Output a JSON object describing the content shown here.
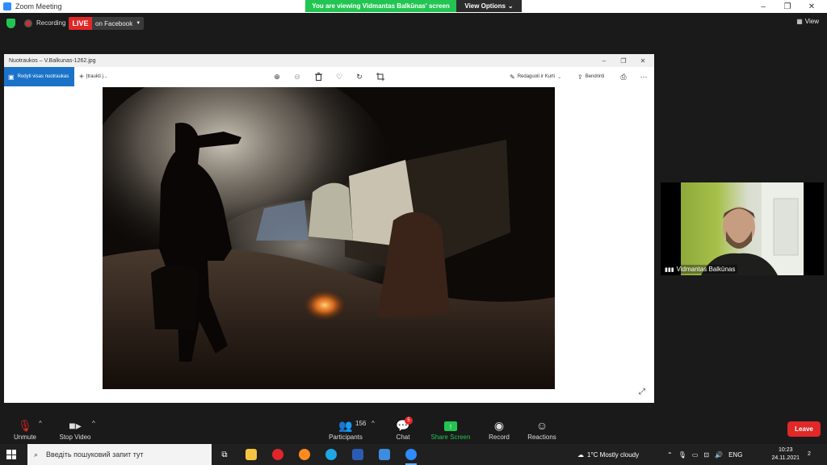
{
  "window": {
    "title": "Zoom Meeting",
    "controls": [
      "–",
      "❐",
      "✕"
    ]
  },
  "banner": {
    "viewing_text": "You are viewing Vidmantas Balkūnas' screen",
    "view_options": "View Options"
  },
  "status": {
    "recording": "Recording",
    "live": "LIVE",
    "live_target": "on Facebook",
    "view_label": "View"
  },
  "shared_window": {
    "title": "Nuotraukos – V.Balkunas-1262.jpg",
    "show_all": "Rodyti visas nuotraukas",
    "add": "Įtraukti į...",
    "edit_create": "Redaguoti ir Kurti",
    "share": "Bendrinti"
  },
  "participant": {
    "name": "Vidmantas Balkūnas"
  },
  "toolbar": {
    "unmute": "Unmute",
    "stop_video": "Stop Video",
    "participants": "Participants",
    "participants_count": "156",
    "chat": "Chat",
    "chat_badge": "5",
    "share_screen": "Share Screen",
    "record": "Record",
    "reactions": "Reactions",
    "leave": "Leave"
  },
  "taskbar": {
    "search_placeholder": "Введіть пошуковий запит тут",
    "weather": "1°C  Mostly cloudy",
    "language": "ENG",
    "time": "10:23",
    "date": "24.11.2021",
    "notifications": "2"
  },
  "colors": {
    "zoom_green": "#23c552",
    "live_red": "#e02828",
    "photos_blue": "#1a73c8",
    "toolbar_bg": "#1a1a1a"
  }
}
